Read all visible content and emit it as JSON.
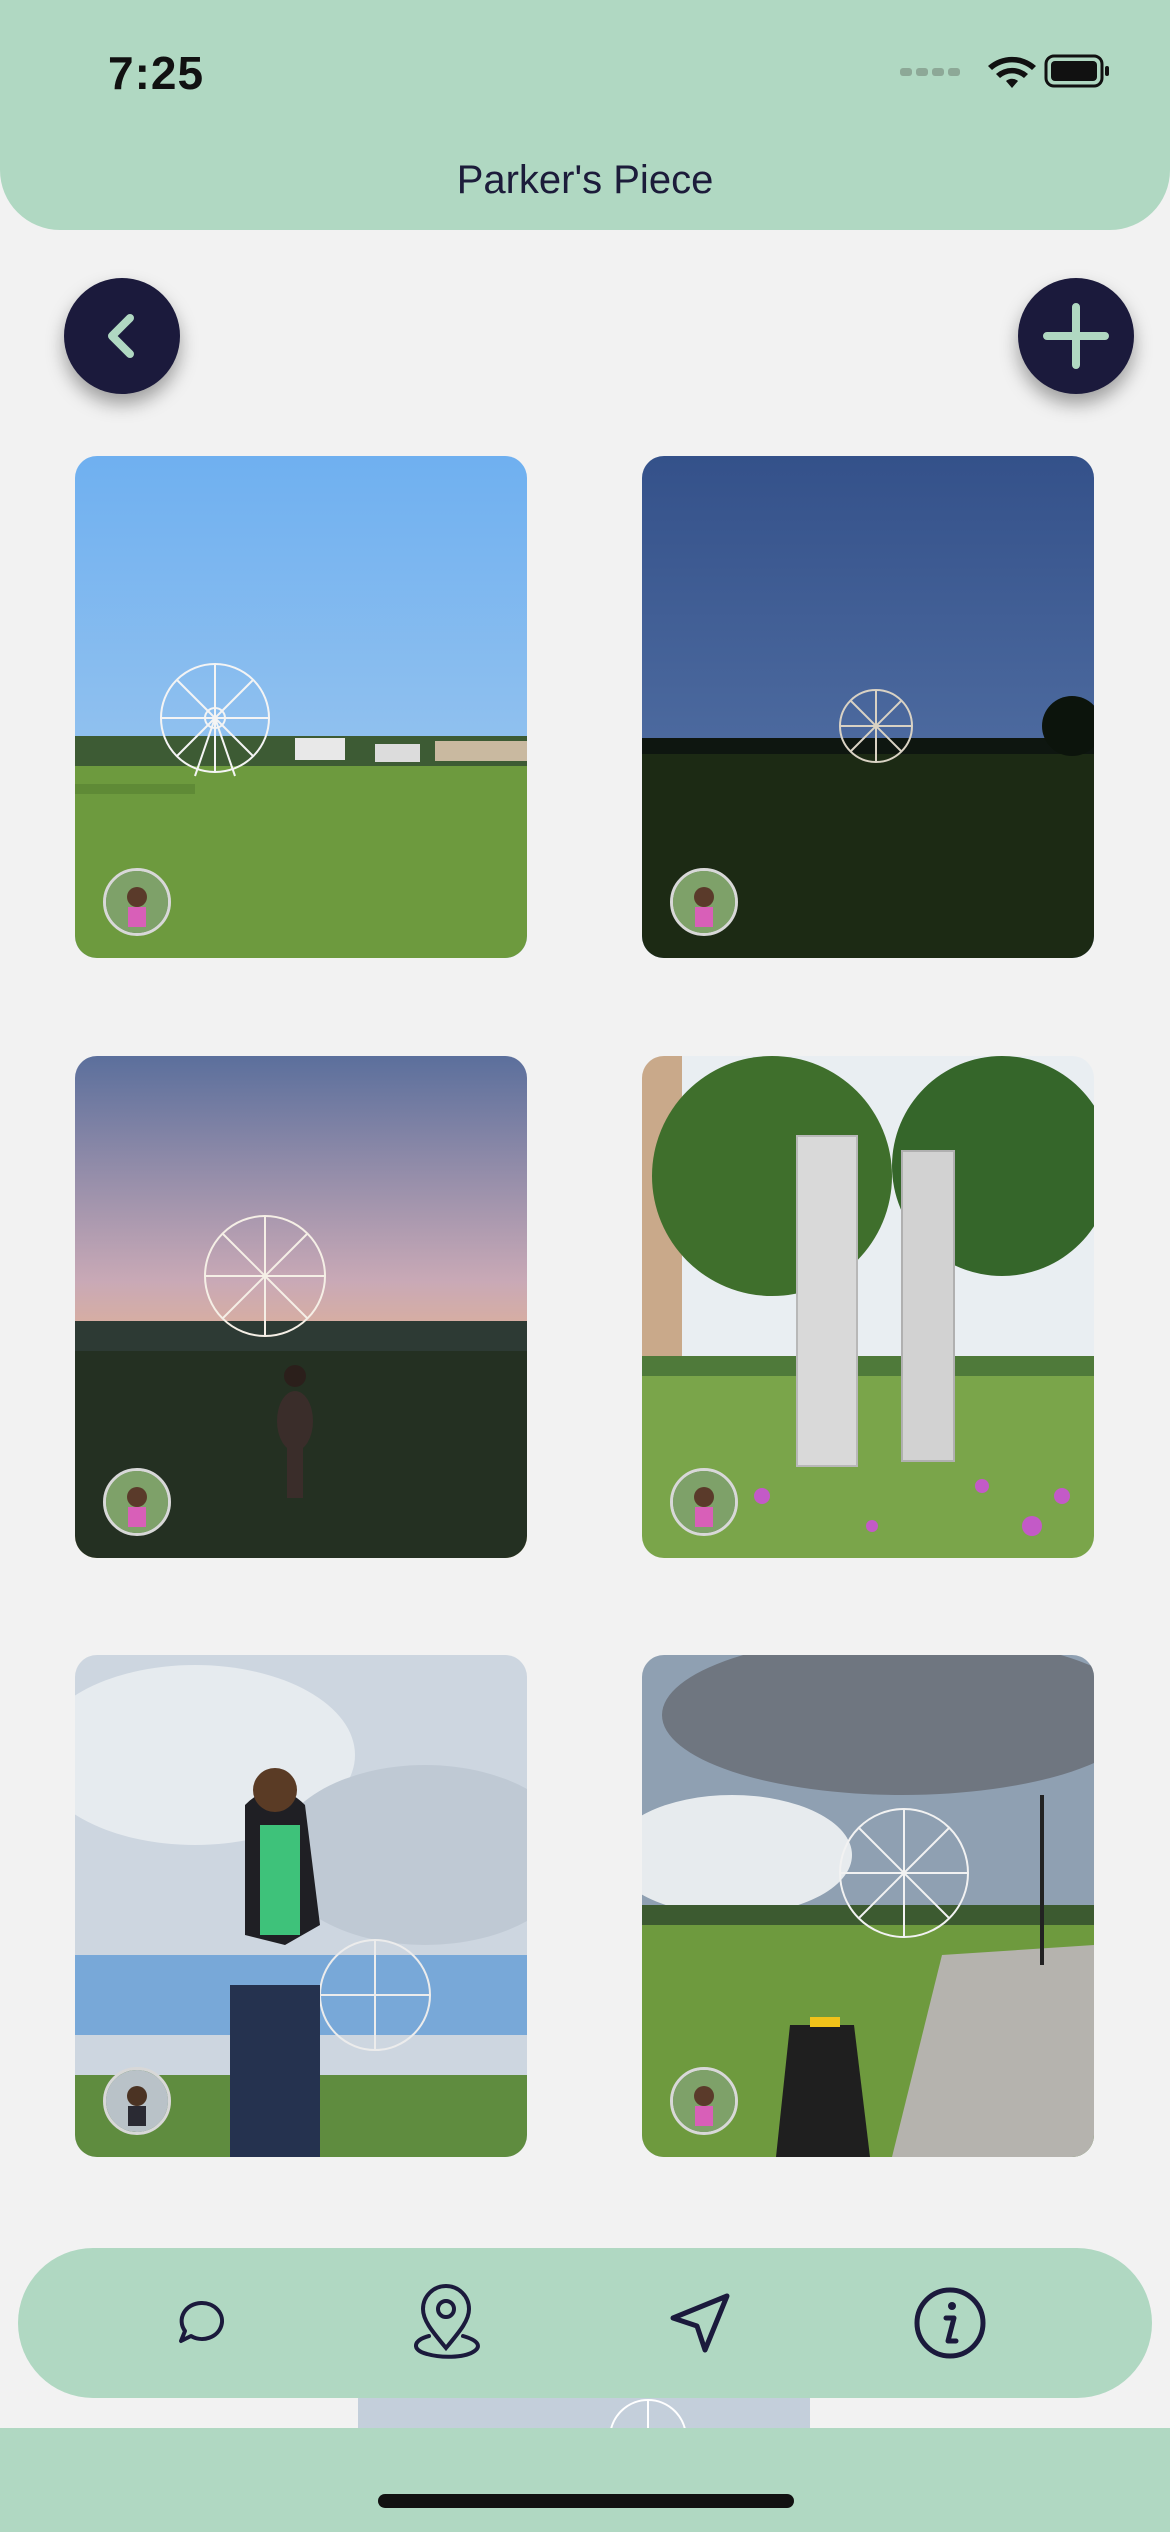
{
  "status_bar": {
    "time": "7:25"
  },
  "header": {
    "title": "Parker's Piece"
  },
  "buttons": {
    "back_icon": "chevron-left-icon",
    "add_icon": "plus-icon"
  },
  "gallery": [
    {
      "scene": "ferris-wheel-day"
    },
    {
      "scene": "ferris-wheel-dusk"
    },
    {
      "scene": "ferris-wheel-sunset-person"
    },
    {
      "scene": "stone-monoliths-wildflowers"
    },
    {
      "scene": "person-cloudy-sky"
    },
    {
      "scene": "ferris-wheel-path-sign"
    }
  ],
  "tabbar": {
    "items": [
      {
        "icon": "chat-bubble-icon"
      },
      {
        "icon": "map-pin-icon"
      },
      {
        "icon": "navigation-arrow-icon"
      },
      {
        "icon": "info-icon"
      }
    ]
  },
  "colors": {
    "accent": "#b0d8c2",
    "dark": "#1b1a3c",
    "background": "#f2f2f2"
  }
}
